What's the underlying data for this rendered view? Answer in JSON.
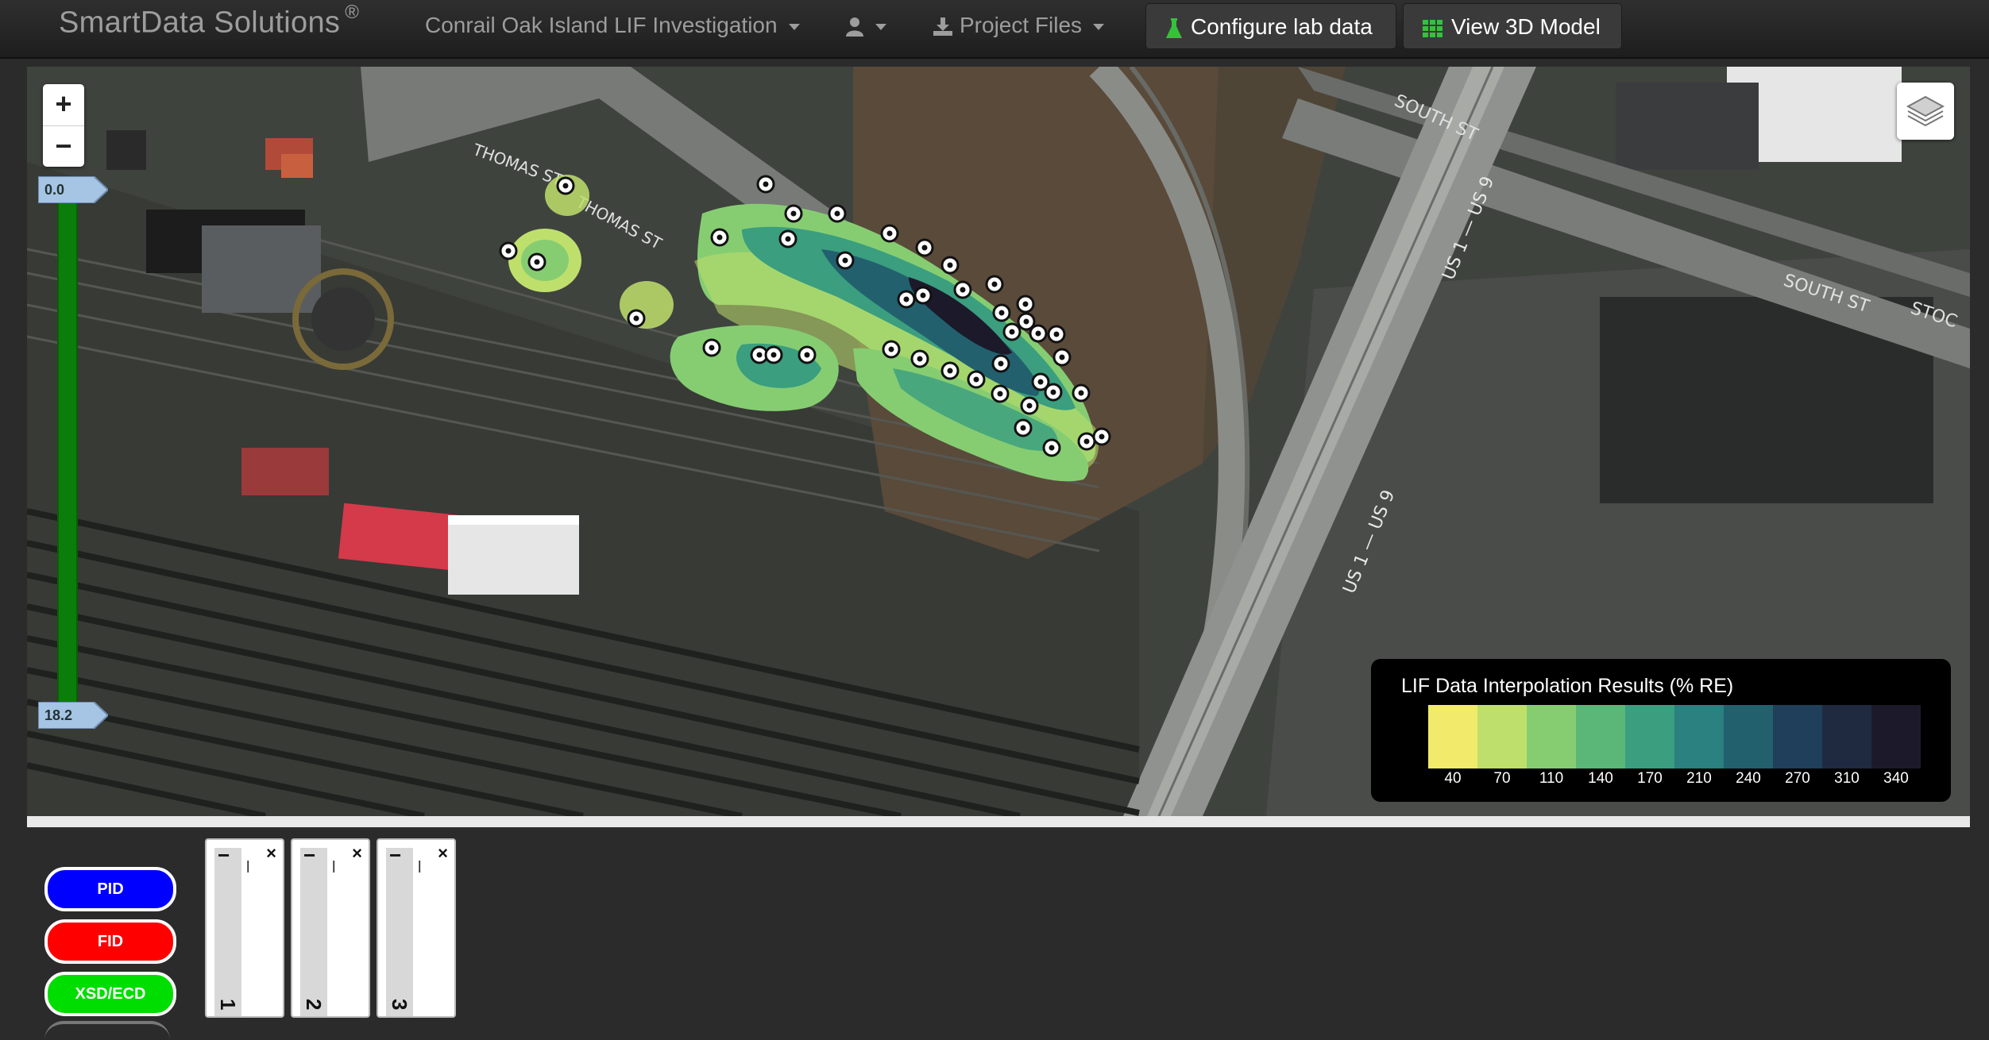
{
  "navbar": {
    "brand": "SmartData Solutions",
    "brand_mark": "®",
    "project_menu": "Conrail Oak Island LIF Investigation",
    "user_menu_icon": "user-icon",
    "files_menu": "Project Files",
    "configure_button": "Configure lab data",
    "view3d_button": "View 3D Model"
  },
  "map": {
    "zoom_in": "+",
    "zoom_out": "−",
    "depth_slider": {
      "top_label": "0.0",
      "bottom_label": "18.2"
    },
    "street_labels": [
      "THOMAS ST",
      "THOMAS ST",
      "SOUTH ST",
      "SOUTH ST",
      "STOC",
      "US 1 — US 9",
      "US 1 — US 9"
    ],
    "legend": {
      "title": "LIF Data Interpolation Results (% RE)",
      "colors": [
        "#f1ea6b",
        "#bfdf6c",
        "#86cd72",
        "#5ab778",
        "#3a9e7f",
        "#2b8080",
        "#22606e",
        "#1f3f5a",
        "#1f2a40",
        "#1c1a2a"
      ],
      "labels": [
        "40",
        "70",
        "110",
        "140",
        "170",
        "210",
        "240",
        "270",
        "310",
        "340"
      ]
    }
  },
  "detector_buttons": [
    "PID",
    "FID",
    "XSD/ECD"
  ],
  "boring_cards": [
    {
      "minus": "−",
      "label": "l",
      "close": "×",
      "number": "1"
    },
    {
      "minus": "−",
      "label": "l",
      "close": "×",
      "number": "2"
    },
    {
      "minus": "−",
      "label": "l",
      "close": "×",
      "number": "3"
    }
  ]
}
